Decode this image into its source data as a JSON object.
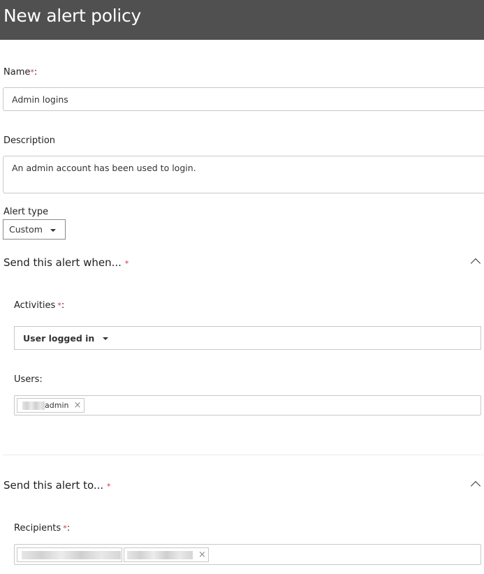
{
  "page_title": "New alert policy",
  "name": {
    "label": "Name",
    "required_mark": "*",
    "colon": ":",
    "value": "Admin logins"
  },
  "description": {
    "label": "Description",
    "value": "An admin account has been used to login."
  },
  "alert_type": {
    "label": "Alert type",
    "selected": "Custom"
  },
  "send_when": {
    "title": "Send this alert when...",
    "required_mark": "*",
    "activities": {
      "label": "Activities",
      "required_mark": "*",
      "colon": ":",
      "selected": "User logged in"
    },
    "users": {
      "label": "Users:",
      "tokens": [
        {
          "text": "admin",
          "remove": "×"
        }
      ]
    }
  },
  "send_to": {
    "title": "Send this alert to...",
    "required_mark": "*",
    "recipients": {
      "label": "Recipients",
      "required_mark": "*",
      "colon": ":",
      "remove": "×"
    }
  }
}
